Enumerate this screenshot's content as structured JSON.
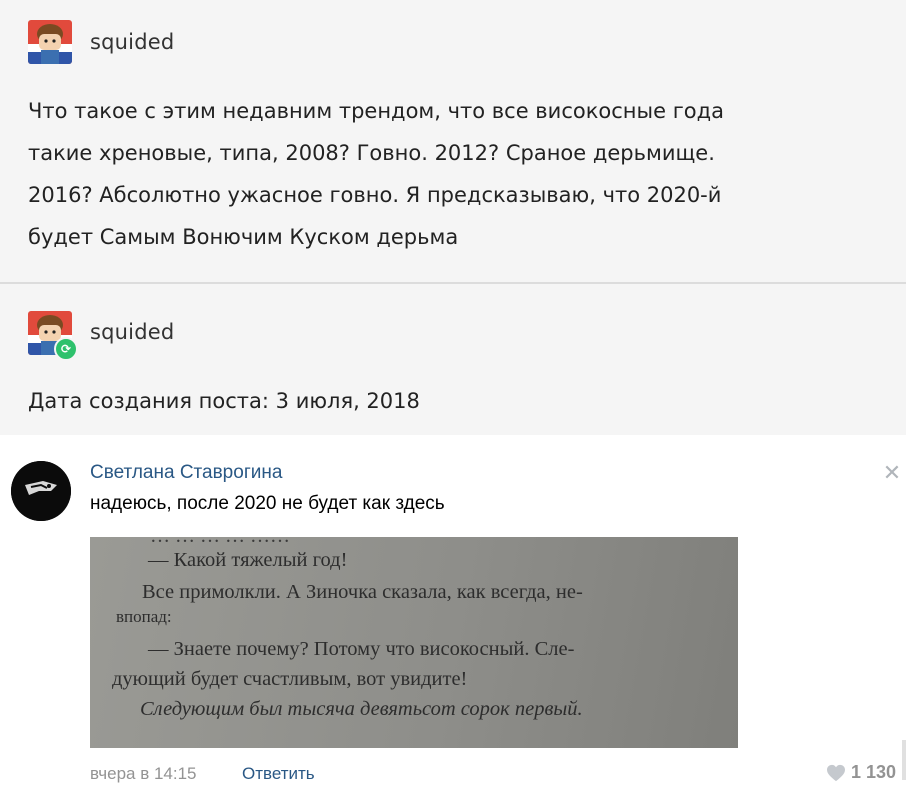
{
  "tumblr": {
    "post": {
      "username": "squided",
      "text_lines": [
        "Что такое с этим недавним трендом, что все високосные года",
        "такие хреновые, типа, 2008? Говно. 2012? Сраное дерьмище.",
        "2016? Абсолютно ужасное говно. Я предсказываю, что 2020-й",
        "будет Самым Вонючим Куском дерьма"
      ]
    },
    "reblog": {
      "username": "squided",
      "text": "Дата создания поста: 3 июля, 2018",
      "badge_icon": "reblog-icon"
    }
  },
  "comment": {
    "author": "Светлана Ставрогина",
    "text": "надеюсь, после 2020 не будет как здесь",
    "close_icon": "close-icon",
    "image": {
      "cut_line": "… … … … ……",
      "lines": [
        "— Какой тяжелый год!",
        "Все примолкли. А Зиночка сказала, как всегда, не-",
        "впопад:",
        "— Знаете почему? Потому что високосный. Сле-",
        "дующий будет счастливым, вот увидите!",
        "Следующим был тысяча девятьсот сорок первый."
      ]
    },
    "time": "вчера в 14:15",
    "reply_label": "Ответить",
    "likes": "1 130"
  },
  "colors": {
    "link": "#2a5885",
    "muted": "#939393",
    "tumblr_bg": "#f5f5f5",
    "reblog_green": "#2ec16c"
  }
}
